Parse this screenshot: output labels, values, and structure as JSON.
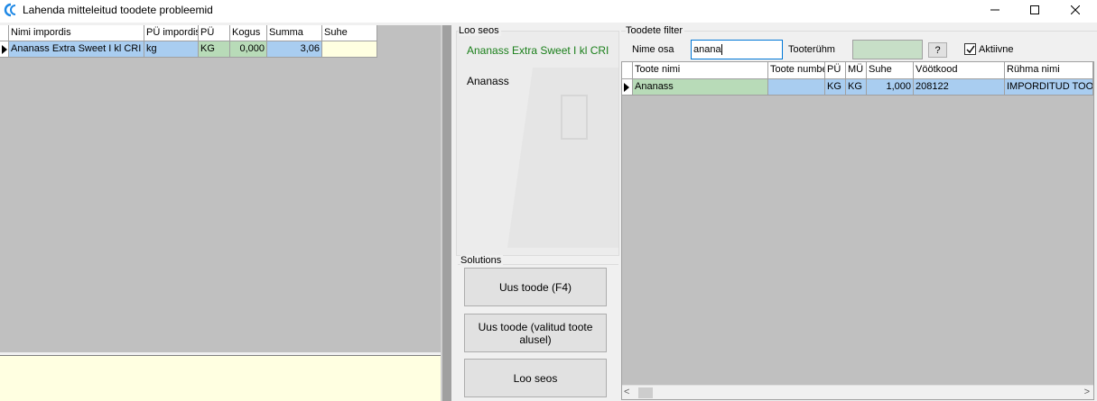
{
  "window": {
    "title": "Lahenda mitteleitud toodete probleemid",
    "minimize_icon": "minimize-icon",
    "maximize_icon": "maximize-icon",
    "close_icon": "close-icon"
  },
  "import_grid": {
    "columns": [
      "Nimi impordis",
      "PÜ impordis",
      "PÜ",
      "Kogus",
      "Summa",
      "Suhe"
    ],
    "rows": [
      {
        "name": "Ananass Extra Sweet I kl CRI",
        "unit_import": "kg",
        "unit": "KG",
        "quantity": "0,000",
        "sum": "3,06",
        "ratio": ""
      }
    ]
  },
  "link_panel": {
    "title": "Loo seos",
    "product_name": "Ananass Extra Sweet I kl CRI",
    "linked_name": "Ananass"
  },
  "solutions": {
    "title": "Solutions",
    "buttons": [
      "Uus toode (F4)",
      "Uus toode (valitud toote alusel)",
      "Loo seos"
    ]
  },
  "filter": {
    "title": "Toodete filter",
    "name_label": "Nime osa",
    "name_value": "anana",
    "group_label": "Tooterühm",
    "group_value": "",
    "help_button": "?",
    "active_label": "Aktiivne",
    "active_checked": true
  },
  "product_grid": {
    "columns": [
      "Toote nimi",
      "Toote number",
      "PÜ",
      "MÜ",
      "Suhe",
      "Vöötkood",
      "Rühma nimi"
    ],
    "rows": [
      {
        "name": "Ananass",
        "number": "",
        "unit": "KG",
        "mu": "KG",
        "ratio": "1,000",
        "barcode": "208122",
        "group": "IMPORDITUD TOOTED"
      }
    ]
  },
  "colors": {
    "selected_blue": "#a9cdf0",
    "selected_green": "#b8dbb8",
    "note_yellow": "#ffffe1",
    "grid_gray": "#c0c0c0",
    "link_green": "#1a7f1a"
  }
}
